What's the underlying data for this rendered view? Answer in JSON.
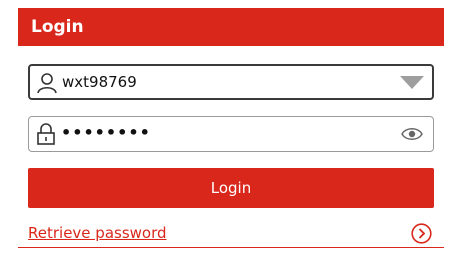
{
  "header": {
    "title": "Login"
  },
  "username": {
    "value": "wxt98769",
    "icon": "user-icon"
  },
  "password": {
    "masked_value": "••••••••",
    "icon": "lock-icon",
    "toggle_icon": "eye-icon"
  },
  "login_button": {
    "label": "Login"
  },
  "retrieve": {
    "label": "Retrieve password",
    "icon": "chevron-right-circle-icon"
  },
  "colors": {
    "accent": "#d9271c",
    "text": "#111111"
  }
}
